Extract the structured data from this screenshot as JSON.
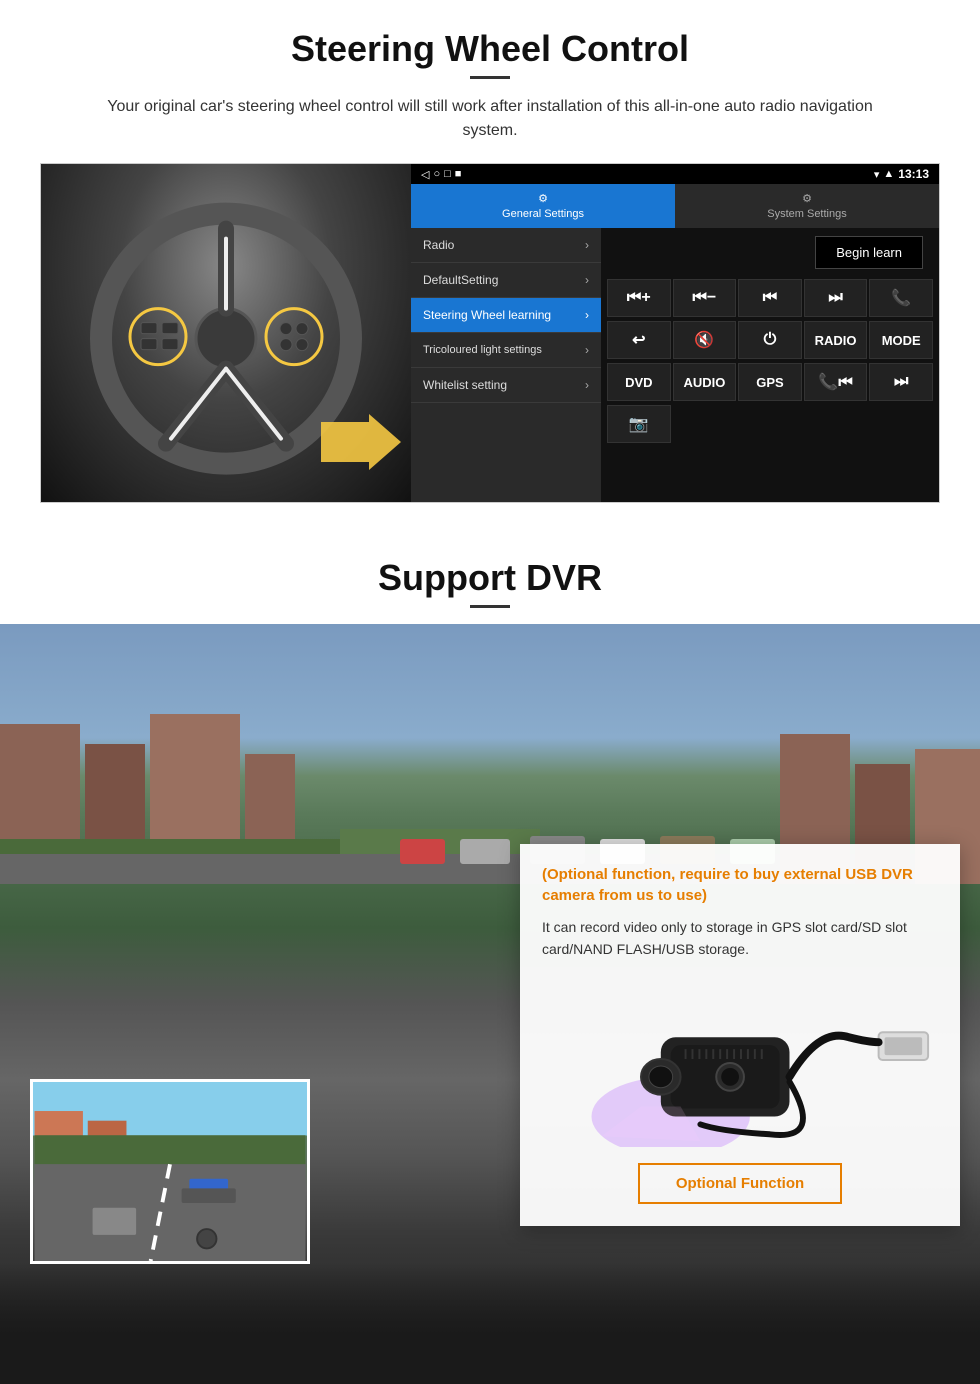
{
  "page": {
    "section1": {
      "title": "Steering Wheel Control",
      "subtitle": "Your original car's steering wheel control will still work after installation of this all-in-one auto radio navigation system.",
      "statusbar": {
        "time": "13:13",
        "icons": "signal wifi battery"
      },
      "navButtons": [
        "◁",
        "○",
        "□",
        "■"
      ],
      "tabs": {
        "general": {
          "label": "General Settings",
          "icon": "⚙"
        },
        "system": {
          "label": "System Settings",
          "icon": "🔧"
        }
      },
      "menuItems": [
        {
          "label": "Radio",
          "active": false
        },
        {
          "label": "DefaultSetting",
          "active": false
        },
        {
          "label": "Steering Wheel learning",
          "active": true
        },
        {
          "label": "Tricoloured light settings",
          "active": false
        },
        {
          "label": "Whitelist setting",
          "active": false
        }
      ],
      "beginLearnButton": "Begin learn",
      "controlButtons": [
        {
          "label": "⏮+",
          "row": 1
        },
        {
          "label": "⏮-",
          "row": 1
        },
        {
          "label": "⏮⏮",
          "row": 1
        },
        {
          "label": "⏭⏭",
          "row": 1
        },
        {
          "label": "📞",
          "row": 1
        },
        {
          "label": "↩",
          "row": 2
        },
        {
          "label": "🔇x",
          "row": 2
        },
        {
          "label": "⏻",
          "row": 2
        },
        {
          "label": "RADIO",
          "row": 2
        },
        {
          "label": "MODE",
          "row": 2
        },
        {
          "label": "DVD",
          "row": 3
        },
        {
          "label": "AUDIO",
          "row": 3
        },
        {
          "label": "GPS",
          "row": 3
        },
        {
          "label": "📞⏮",
          "row": 3
        },
        {
          "label": "⏭",
          "row": 3
        },
        {
          "label": "📷",
          "row": 4
        }
      ]
    },
    "section2": {
      "title": "Support DVR",
      "card": {
        "orangeText": "(Optional function, require to buy external USB DVR camera from us to use)",
        "bodyText": "It can record video only to storage in GPS slot card/SD slot card/NAND FLASH/USB storage.",
        "buttonLabel": "Optional Function"
      }
    }
  }
}
